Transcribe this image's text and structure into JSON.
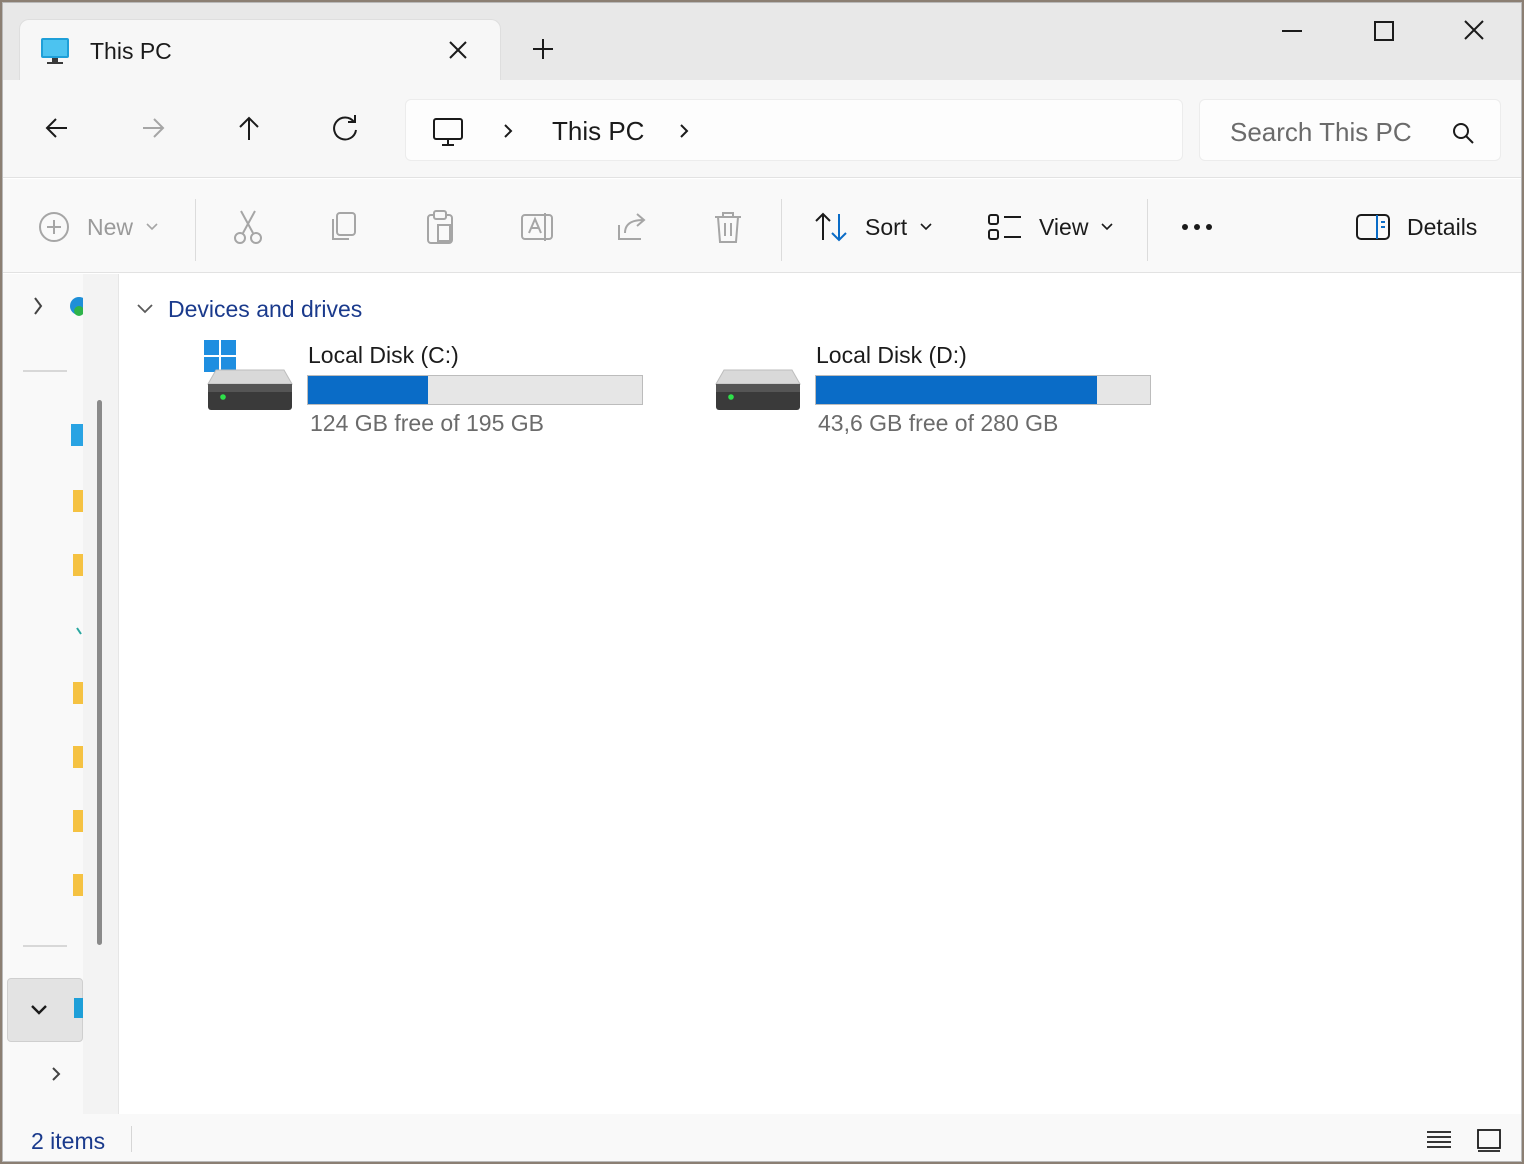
{
  "window": {
    "tab_title": "This PC",
    "tab_icon": "monitor-icon",
    "new_tab_icon": "plus-icon",
    "controls": [
      "minimize-icon",
      "maximize-icon",
      "close-icon"
    ]
  },
  "nav": {
    "buttons": [
      "back-arrow-icon",
      "forward-arrow-icon",
      "up-arrow-icon",
      "refresh-icon"
    ],
    "breadcrumb": [
      "This PC"
    ],
    "search_placeholder": "Search This PC"
  },
  "commands": {
    "new_label": "New",
    "sort_label": "Sort",
    "view_label": "View",
    "details_label": "Details",
    "disabled_actions": [
      "cut-icon",
      "copy-icon",
      "paste-icon",
      "rename-icon",
      "share-icon",
      "delete-icon"
    ]
  },
  "content": {
    "group_title": "Devices and drives",
    "drives": [
      {
        "name": "Local Disk (C:)",
        "free_text": "124 GB free of 195 GB",
        "used_fraction": 0.36,
        "has_windows_logo": true
      },
      {
        "name": "Local Disk (D:)",
        "free_text": "43,6 GB free of 280 GB",
        "used_fraction": 0.84,
        "has_windows_logo": false
      }
    ]
  },
  "status": {
    "item_count": "2 items"
  },
  "colors": {
    "accent": "#0a6cc7",
    "link_text": "#1a3a8c",
    "folder": "#f5c242"
  }
}
